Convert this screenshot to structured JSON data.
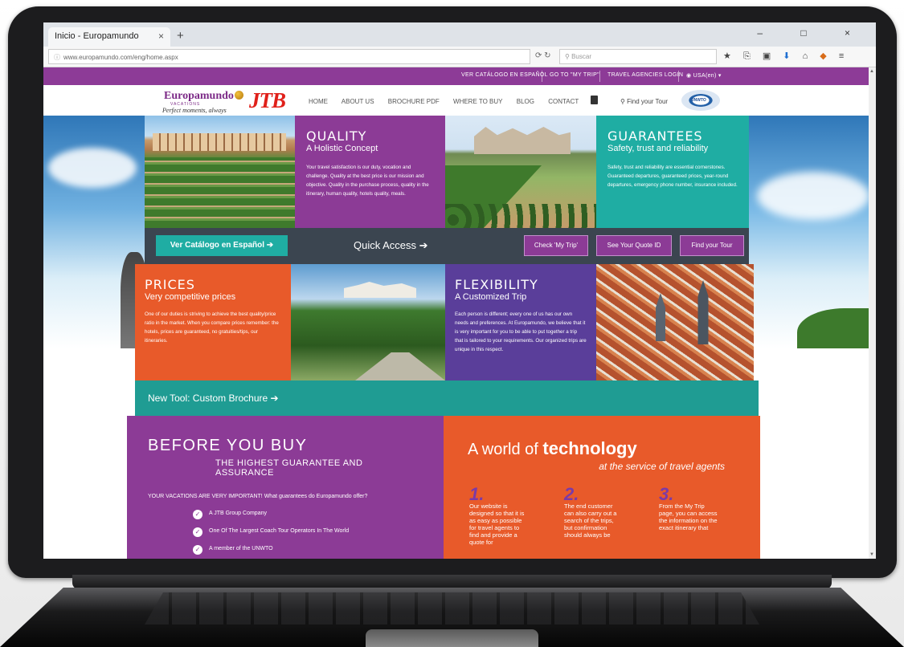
{
  "browser": {
    "tab_title": "Inicio - Europamundo",
    "tab_close": "×",
    "new_tab": "+",
    "window_controls": "– □ ×",
    "url": "www.europamundo.com/eng/home.aspx",
    "url_host": "www.europamundo.com",
    "nav_icons": "⟳ ↻",
    "search_placeholder": "Buscar",
    "toolbar_icons": [
      "★",
      "⎘",
      "▣",
      "⬇",
      "⌂",
      "◆",
      "≡"
    ]
  },
  "topbar": {
    "items": [
      "VER CATÁLOGO EN ESPAÑOL",
      "GO TO \"MY TRIP\"",
      "TRAVEL AGENCIES LOGIN",
      "USA(en) ▾"
    ],
    "color": "#8d3b97"
  },
  "header": {
    "logo_main": "Europamundo",
    "logo_sub": "VACATIONS",
    "logo_tagline": "Perfect moments, always",
    "logo_partner": "JTB",
    "nav": [
      "HOME",
      "ABOUT US",
      "BROCHURE PDF",
      "WHERE TO BUY",
      "BLOG",
      "CONTACT"
    ],
    "find_tour": "Find your Tour",
    "unwto_label": "UNWTO"
  },
  "tiles": {
    "quality": {
      "title": "QUALITY",
      "subtitle": "A Holistic Concept",
      "text": "Your travel satisfaction is our duty, vocation and challenge. Quality at the best price is our mission and objective. Quality in the purchase process, quality in the itinerary, human quality, hotels quality, meals."
    },
    "guarantees": {
      "title": "GUARANTEES",
      "subtitle": "Safety, trust and reliability",
      "text": "Safety, trust and reliability are essential cornerstones. Guaranteed departures, guaranteed prices, year-round departures, emergency phone number, insurance included."
    },
    "prices": {
      "title": "PRICES",
      "subtitle": "Very competitive prices",
      "text": "One of our duties is striving to achieve the best quality/price ratio in the market. When you compare prices remember: the hotels, prices are guaranteed, no gratuities/tips, our itineraries."
    },
    "flexibility": {
      "title": "FLEXIBILITY",
      "subtitle": "A Customized Trip",
      "text": "Each person is different; every one of us has our own needs and preferences. At Europamundo, we believe that it is very important for you to be able to put together a trip that is tailored to your requirements. Our organized trips are unique in this respect."
    }
  },
  "quick_access": {
    "catalog_button": "Ver Catálogo en Español ➔",
    "label": "Quick Access ➔",
    "buttons": [
      "Check 'My Trip'",
      "See Your Quote ID",
      "Find your Tour"
    ]
  },
  "new_tool": "New Tool: Custom Brochure ➔",
  "before_you_buy": {
    "title": "BEFORE YOU BUY",
    "subtitle": "THE HIGHEST GUARANTEE AND ASSURANCE",
    "question": "YOUR VACATIONS ARE VERY IMPORTANT! What guarantees do Europamundo offer?",
    "items": [
      "A JTB Group Company",
      "One Of The Largest Coach Tour Operators In The World",
      "A member of the UNWTO"
    ]
  },
  "technology": {
    "title_prefix": "A world of ",
    "title_bold": "technology",
    "subtitle": "at the service of travel agents",
    "steps": [
      {
        "num": "1.",
        "text": "Our website is designed so that it is as easy as possible for travel agents to find and provide a quote for"
      },
      {
        "num": "2.",
        "text": "The end customer can also carry out a search of the trips, but confirmation should always be"
      },
      {
        "num": "3.",
        "text": "From the My Trip page, you can access the information on the exact itinerary that"
      }
    ]
  },
  "colors": {
    "purple": "#8c3b96",
    "teal": "#1fada3",
    "orange": "#e85a2a",
    "violet": "#5a3e9a",
    "dark": "#3b4550"
  }
}
